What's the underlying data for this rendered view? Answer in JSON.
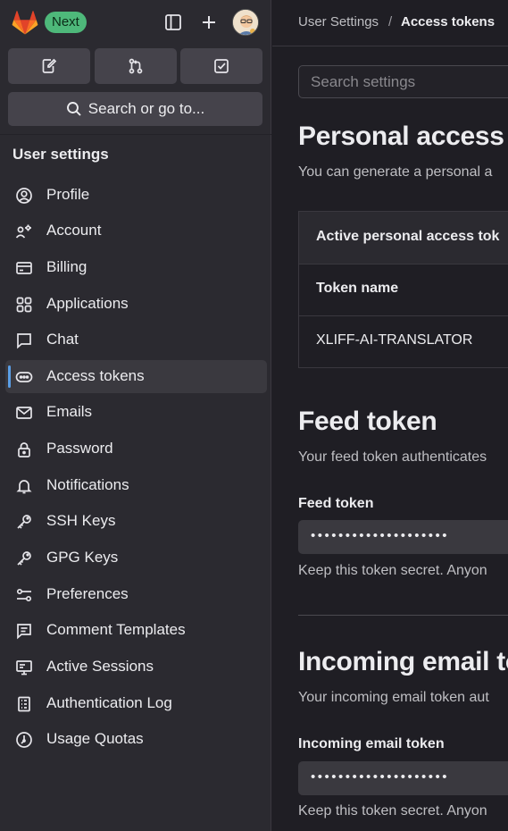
{
  "topbar": {
    "next_badge": "Next"
  },
  "sidebar": {
    "search_label": "Search or go to...",
    "heading": "User settings",
    "items": [
      {
        "label": "Profile",
        "icon": "profile-icon"
      },
      {
        "label": "Account",
        "icon": "account-icon"
      },
      {
        "label": "Billing",
        "icon": "billing-icon"
      },
      {
        "label": "Applications",
        "icon": "applications-icon"
      },
      {
        "label": "Chat",
        "icon": "chat-icon"
      },
      {
        "label": "Access tokens",
        "icon": "access-tokens-icon",
        "active": true
      },
      {
        "label": "Emails",
        "icon": "email-icon"
      },
      {
        "label": "Password",
        "icon": "lock-icon"
      },
      {
        "label": "Notifications",
        "icon": "bell-icon"
      },
      {
        "label": "SSH Keys",
        "icon": "key-icon"
      },
      {
        "label": "GPG Keys",
        "icon": "key-icon"
      },
      {
        "label": "Preferences",
        "icon": "preferences-icon"
      },
      {
        "label": "Comment Templates",
        "icon": "comment-icon"
      },
      {
        "label": "Active Sessions",
        "icon": "monitor-icon"
      },
      {
        "label": "Authentication Log",
        "icon": "log-icon"
      },
      {
        "label": "Usage Quotas",
        "icon": "quota-icon"
      }
    ]
  },
  "breadcrumb": {
    "parent": "User Settings",
    "separator": "/",
    "current": "Access tokens"
  },
  "search": {
    "placeholder": "Search settings"
  },
  "pat": {
    "title": "Personal access t",
    "description": "You can generate a personal a",
    "table_header": "Active personal access tok",
    "column_token_name": "Token name",
    "rows": [
      {
        "token_name": "XLIFF-AI-TRANSLATOR"
      }
    ]
  },
  "feed": {
    "title": "Feed token",
    "description": "Your feed token authenticates",
    "label": "Feed token",
    "masked_value": "••••••••••••••••••••",
    "help": "Keep this token secret. Anyon"
  },
  "incoming": {
    "title": "Incoming email to",
    "description": "Your incoming email token aut",
    "label": "Incoming email token",
    "masked_value": "••••••••••••••••••••",
    "help": "Keep this token secret. Anyon"
  },
  "colors": {
    "sidebar_bg": "#2b2a30",
    "main_bg": "#1f1e24",
    "badge_green": "#4eb87a",
    "active_indicator": "#5a9ee6",
    "logo_orange": "#fc6d26"
  }
}
